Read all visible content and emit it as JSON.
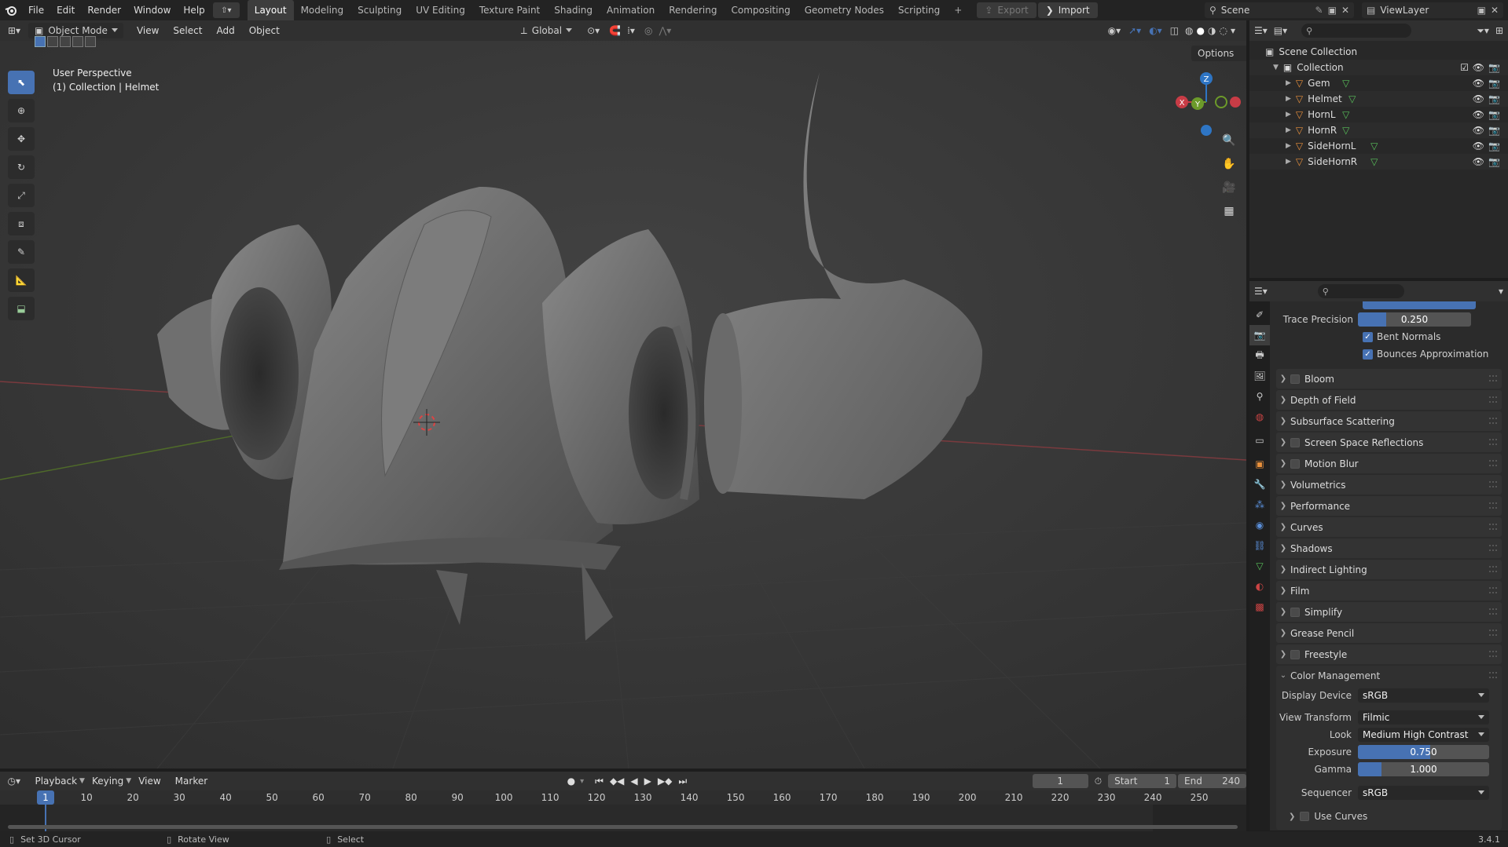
{
  "topbar": {
    "menus": [
      "File",
      "Edit",
      "Render",
      "Window",
      "Help"
    ],
    "workspaces": [
      "Layout",
      "Modeling",
      "Sculpting",
      "UV Editing",
      "Texture Paint",
      "Shading",
      "Animation",
      "Rendering",
      "Compositing",
      "Geometry Nodes",
      "Scripting"
    ],
    "active_workspace": "Layout",
    "export_label": "Export",
    "import_label": "Import",
    "scene_name": "Scene",
    "view_layer": "ViewLayer"
  },
  "viewport": {
    "mode": "Object Mode",
    "menus": [
      "View",
      "Select",
      "Add",
      "Object"
    ],
    "orientation": "Global",
    "options_label": "Options",
    "overlay_line1": "User Perspective",
    "overlay_line2": "(1) Collection | Helmet",
    "gizmo": {
      "z": "Z",
      "y": "Y",
      "x": "X"
    },
    "colors": {
      "x_axis": "#c83c46",
      "y_axis": "#6c9a2a",
      "z_axis": "#2e75c4",
      "active_tool": "#4772b3"
    }
  },
  "outliner": {
    "root": "Scene Collection",
    "collection": "Collection",
    "objects": [
      "Gem",
      "Helmet",
      "HornL",
      "HornR",
      "SideHornL",
      "SideHornR"
    ]
  },
  "properties": {
    "trace_precision_label": "Trace Precision",
    "trace_precision": "0.250",
    "bent_normals": "Bent Normals",
    "bounces_approx": "Bounces Approximation",
    "panels": [
      {
        "label": "Bloom",
        "checkbox": true
      },
      {
        "label": "Depth of Field",
        "checkbox": false
      },
      {
        "label": "Subsurface Scattering",
        "checkbox": false
      },
      {
        "label": "Screen Space Reflections",
        "checkbox": true
      },
      {
        "label": "Motion Blur",
        "checkbox": true
      },
      {
        "label": "Volumetrics",
        "checkbox": false
      },
      {
        "label": "Performance",
        "checkbox": false
      },
      {
        "label": "Curves",
        "checkbox": false
      },
      {
        "label": "Shadows",
        "checkbox": false
      },
      {
        "label": "Indirect Lighting",
        "checkbox": false
      },
      {
        "label": "Film",
        "checkbox": false
      },
      {
        "label": "Simplify",
        "checkbox": true
      },
      {
        "label": "Grease Pencil",
        "checkbox": false
      },
      {
        "label": "Freestyle",
        "checkbox": true
      }
    ],
    "color_management": {
      "label": "Color Management",
      "display_device_label": "Display Device",
      "display_device": "sRGB",
      "view_transform_label": "View Transform",
      "view_transform": "Filmic",
      "look_label": "Look",
      "look": "Medium High Contrast",
      "exposure_label": "Exposure",
      "exposure": "0.750",
      "gamma_label": "Gamma",
      "gamma": "1.000",
      "sequencer_label": "Sequencer",
      "sequencer": "sRGB",
      "use_curves": "Use Curves"
    }
  },
  "timeline": {
    "menus": [
      "Playback",
      "Keying",
      "View",
      "Marker"
    ],
    "current_frame": "1",
    "start_label": "Start",
    "start": "1",
    "end_label": "End",
    "end": "240",
    "ticks": [
      "1",
      "10",
      "20",
      "30",
      "40",
      "50",
      "60",
      "70",
      "80",
      "90",
      "100",
      "110",
      "120",
      "130",
      "140",
      "150",
      "160",
      "170",
      "180",
      "190",
      "200",
      "210",
      "220",
      "230",
      "240",
      "250"
    ]
  },
  "status": {
    "left": "Set 3D Cursor",
    "middle": "Rotate View",
    "right": "Select",
    "version": "3.4.1"
  }
}
